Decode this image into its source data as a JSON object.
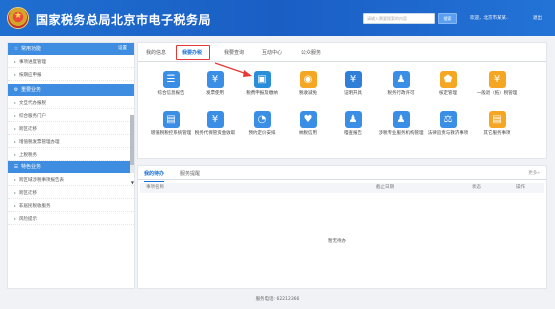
{
  "header": {
    "title": "国家税务总局北京市电子税务局",
    "search_placeholder": "请输入需要搜索的内容",
    "search_button": "搜索",
    "welcome": "欢迎，北京市某某..",
    "logout": "退出"
  },
  "sidebar": {
    "common_title": "常用功能",
    "settings": "设置",
    "common_items": [
      "事项进度管理",
      "按期应申报"
    ],
    "business_title": "重要业务",
    "business_items": [
      "文旦代办报税",
      "综合服务门户",
      "跨区迁移",
      "增值税发票管理办理",
      "上税税务"
    ],
    "special_title": "特色业务",
    "special_items": [
      "跨区域涉税事项报告表",
      "跨区迁移",
      "非居民税收服务",
      "风险提示"
    ]
  },
  "main": {
    "tabs": [
      "我的信息",
      "我要办税",
      "我要查询",
      "互动中心",
      "公众服务"
    ],
    "active_tab": "我要办税",
    "icons": [
      {
        "label": "综合信息报告",
        "color": "#3a8ee6",
        "glyph": "☰"
      },
      {
        "label": "发票使用",
        "color": "#3a8ee6",
        "glyph": "¥"
      },
      {
        "label": "税费申报及缴纳",
        "color": "#2b8ed9",
        "glyph": "▣"
      },
      {
        "label": "税收减免",
        "color": "#f5a623",
        "glyph": "◉"
      },
      {
        "label": "证明开具",
        "color": "#2f7fd8",
        "glyph": "¥"
      },
      {
        "label": "税务行政许可",
        "color": "#3a8ee6",
        "glyph": "♟"
      },
      {
        "label": "核定管理",
        "color": "#f5a623",
        "glyph": "⬟"
      },
      {
        "label": "一般退（抵）税管理",
        "color": "#f5a623",
        "glyph": "¥"
      },
      {
        "label": "增值税税控系统管理",
        "color": "#3a8ee6",
        "glyph": "▤"
      },
      {
        "label": "税务代保管资金收取",
        "color": "#3a8ee6",
        "glyph": "¥"
      },
      {
        "label": "预约定价安排",
        "color": "#3a8ee6",
        "glyph": "◔"
      },
      {
        "label": "纳税信用",
        "color": "#3a8ee6",
        "glyph": "♥"
      },
      {
        "label": "稽查报告",
        "color": "#3a8ee6",
        "glyph": "♟"
      },
      {
        "label": "涉税专业服务机构管理",
        "color": "#3a8ee6",
        "glyph": "♟"
      },
      {
        "label": "法律追责与救济事项",
        "color": "#3a8ee6",
        "glyph": "⚖"
      },
      {
        "label": "其它服务事项",
        "color": "#f5a623",
        "glyph": "▤"
      }
    ]
  },
  "tasks": {
    "tabs": [
      "我的待办",
      "服务提醒"
    ],
    "more": "更多»",
    "columns": [
      "事项名称",
      "截止日期",
      "状态",
      "操作"
    ],
    "empty": "暂无待办"
  },
  "footer": {
    "service_phone": "服务电话: 62212366"
  },
  "colors": {
    "primary": "#1a6fd6",
    "header_bg": "#1a5ec4",
    "highlight": "#e53935"
  }
}
